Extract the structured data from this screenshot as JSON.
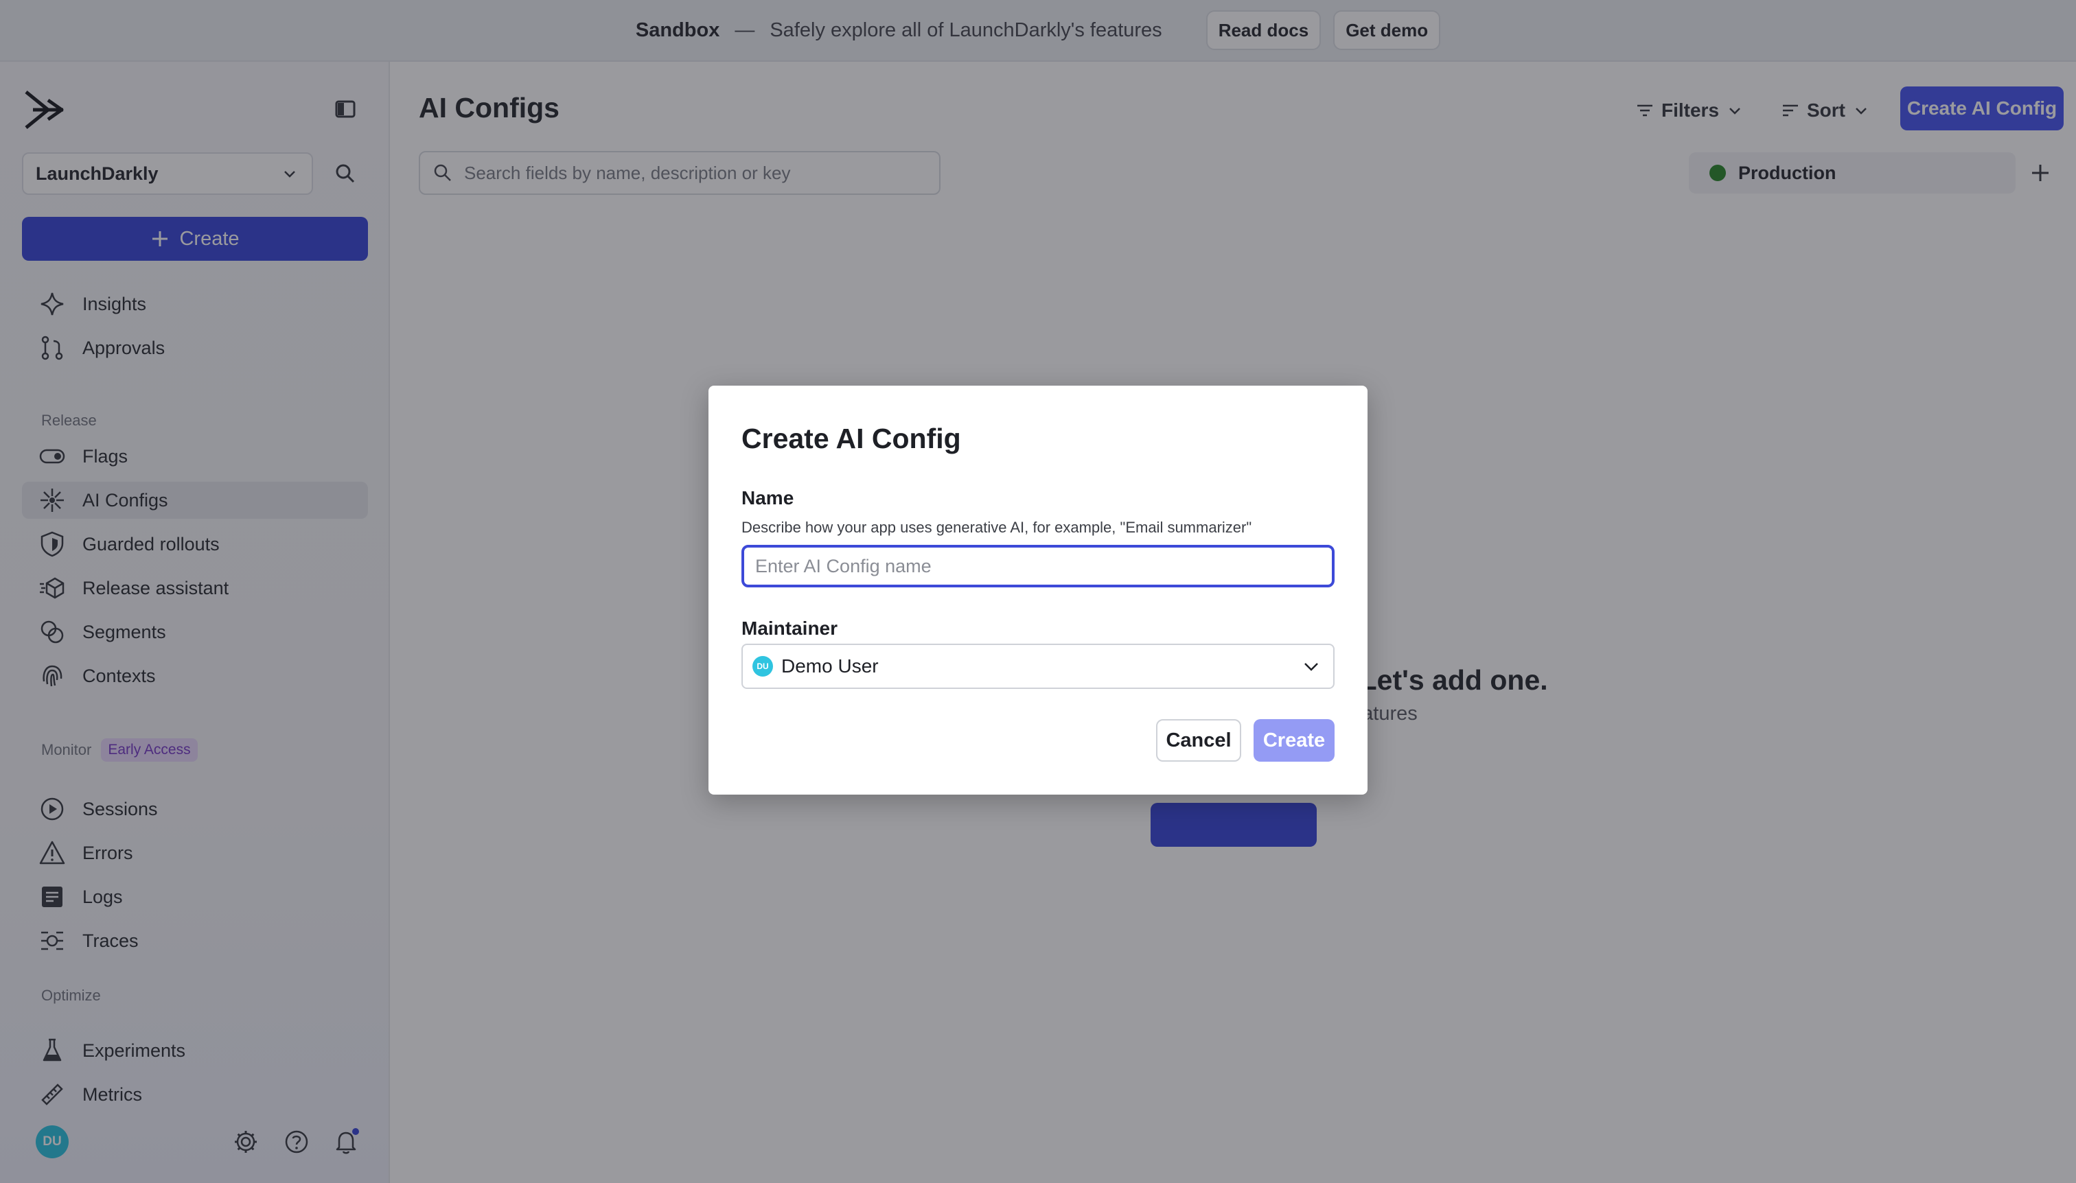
{
  "banner": {
    "title": "Sandbox",
    "separator": "—",
    "message": "Safely explore all of LaunchDarkly's features",
    "read_docs": "Read docs",
    "get_demo": "Get demo"
  },
  "sidebar": {
    "project": "LaunchDarkly",
    "create_label": "Create",
    "top_items": [
      {
        "label": "Insights",
        "icon": "sparkle-icon"
      },
      {
        "label": "Approvals",
        "icon": "git-merge-icon"
      }
    ],
    "sections": {
      "release": "Release",
      "monitor": "Monitor",
      "monitor_badge": "Early Access",
      "optimize": "Optimize"
    },
    "release_items": [
      {
        "label": "Flags",
        "icon": "toggle-icon"
      },
      {
        "label": "AI Configs",
        "icon": "ai-config-icon",
        "active": true
      },
      {
        "label": "Guarded rollouts",
        "icon": "shield-icon"
      },
      {
        "label": "Release assistant",
        "icon": "release-assistant-icon"
      },
      {
        "label": "Segments",
        "icon": "segments-icon"
      },
      {
        "label": "Contexts",
        "icon": "fingerprint-icon"
      }
    ],
    "monitor_items": [
      {
        "label": "Sessions",
        "icon": "play-circle-icon"
      },
      {
        "label": "Errors",
        "icon": "warning-icon"
      },
      {
        "label": "Logs",
        "icon": "logs-icon"
      },
      {
        "label": "Traces",
        "icon": "traces-icon"
      }
    ],
    "optimize_items": [
      {
        "label": "Experiments",
        "icon": "flask-icon"
      },
      {
        "label": "Metrics",
        "icon": "ruler-icon"
      }
    ],
    "user_initials": "DU"
  },
  "main": {
    "title": "AI Configs",
    "filters": "Filters",
    "sort": "Sort",
    "create_button": "Create AI Config",
    "search_placeholder": "Search fields by name, description or key",
    "environment": "Production",
    "empty_title_partial": "gs. Let's add one.",
    "empty_sub_partial": "red features"
  },
  "modal": {
    "title": "Create AI Config",
    "name_label": "Name",
    "name_help": "Describe how your app uses generative AI, for example, \"Email summarizer\"",
    "name_placeholder": "Enter AI Config name",
    "name_value": "",
    "maintainer_label": "Maintainer",
    "maintainer_initials": "DU",
    "maintainer_value": "Demo User",
    "cancel": "Cancel",
    "create": "Create"
  },
  "colors": {
    "brand": "#3d4ad8",
    "create_disabled": "#949bf4",
    "avatar": "#2fc4e0",
    "environment_dot": "#2f8a2f"
  }
}
